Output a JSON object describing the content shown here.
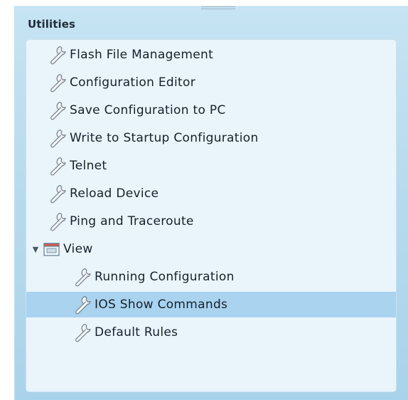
{
  "panel": {
    "heading": "Utilities"
  },
  "tree": {
    "items": [
      {
        "label": "Flash File Management",
        "icon": "wrench-icon"
      },
      {
        "label": "Configuration Editor",
        "icon": "wrench-icon"
      },
      {
        "label": "Save Configuration to PC",
        "icon": "wrench-icon"
      },
      {
        "label": "Write to Startup Configuration",
        "icon": "wrench-icon"
      },
      {
        "label": "Telnet",
        "icon": "wrench-icon"
      },
      {
        "label": "Reload Device",
        "icon": "wrench-icon"
      },
      {
        "label": "Ping and Traceroute",
        "icon": "wrench-icon"
      },
      {
        "label": "View",
        "icon": "folder-icon",
        "expanded": true,
        "children": [
          {
            "label": "Running Configuration",
            "icon": "wrench-icon"
          },
          {
            "label": "IOS Show Commands",
            "icon": "wrench-icon",
            "selected": true
          },
          {
            "label": "Default Rules",
            "icon": "wrench-icon"
          }
        ]
      }
    ]
  },
  "colors": {
    "panel_background": "#b9dcee",
    "tree_background": "#eaf4fb",
    "selected_row": "#a9d3ef",
    "text": "#17212b"
  }
}
